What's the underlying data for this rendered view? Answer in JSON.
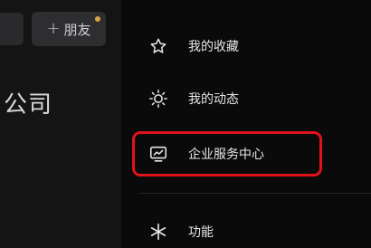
{
  "left_pane": {
    "add_friend_label": "朋友",
    "add_friend_plus": "+",
    "company_text": "公司"
  },
  "drawer": {
    "items": [
      {
        "label": "我的收藏",
        "icon": "star-icon"
      },
      {
        "label": "我的动态",
        "icon": "sun-icon"
      },
      {
        "label": "企业服务中心",
        "icon": "chart-screen-icon",
        "highlighted": true
      },
      {
        "label": "功能",
        "icon": "asterisk-icon"
      }
    ],
    "highlight_color": "#e0121a"
  }
}
